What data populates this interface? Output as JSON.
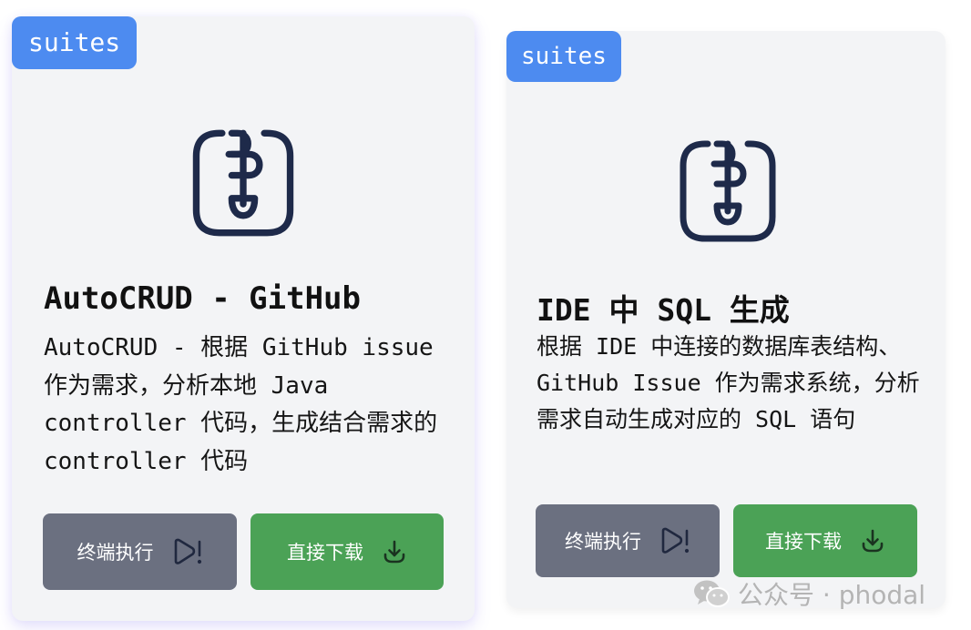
{
  "cards": [
    {
      "tag": "suites",
      "icon": "zip-archive-icon",
      "title": "AutoCRUD - GitHub",
      "description": "AutoCRUD - 根据 GitHub issue 作为需求，分析本地 Java controller 代码，生成结合需求的 controller 代码",
      "run_label": "终端执行",
      "download_label": "直接下载"
    },
    {
      "tag": "suites",
      "icon": "zip-archive-icon",
      "title": "IDE 中 SQL 生成",
      "description": "根据 IDE 中连接的数据库表结构、GitHub Issue 作为需求系统，分析需求自动生成对应的 SQL 语句",
      "run_label": "终端执行",
      "download_label": "直接下载"
    }
  ],
  "watermark": {
    "icon": "wechat-icon",
    "text": "公众号 · phodal"
  },
  "colors": {
    "tag": "#4d8bf0",
    "run_button": "#6b7080",
    "download_button": "#4ba256",
    "card": "#f3f4f6",
    "icon": "#1e2a4a"
  }
}
